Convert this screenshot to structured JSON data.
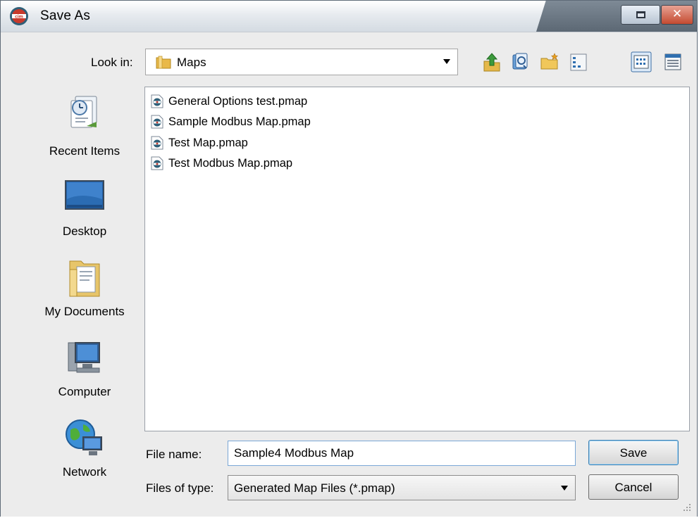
{
  "window": {
    "title": "Save As",
    "app_icon": "cim-logo-icon",
    "maximize_icon": "maximize-icon",
    "close_icon": "close-icon"
  },
  "lookin": {
    "label": "Look in:",
    "value": "Maps",
    "toolbar": [
      "up-one-level-icon",
      "recent-icon",
      "new-folder-icon",
      "view-list-icon",
      "view-details-icon",
      "view-menu-icon"
    ]
  },
  "places": [
    {
      "label": "Recent Items",
      "icon": "recent-items-icon"
    },
    {
      "label": "Desktop",
      "icon": "desktop-icon"
    },
    {
      "label": "My Documents",
      "icon": "my-documents-icon"
    },
    {
      "label": "Computer",
      "icon": "computer-icon"
    },
    {
      "label": "Network",
      "icon": "network-icon"
    }
  ],
  "files": [
    {
      "name": "General Options test.pmap"
    },
    {
      "name": "Sample Modbus Map.pmap"
    },
    {
      "name": "Test Map.pmap"
    },
    {
      "name": "Test Modbus Map.pmap"
    }
  ],
  "form": {
    "file_name_label": "File name:",
    "file_name_value": "Sample4 Modbus Map",
    "file_type_label": "Files of type:",
    "file_type_value": "Generated Map Files (*.pmap)"
  },
  "buttons": {
    "save": "Save",
    "cancel": "Cancel"
  }
}
